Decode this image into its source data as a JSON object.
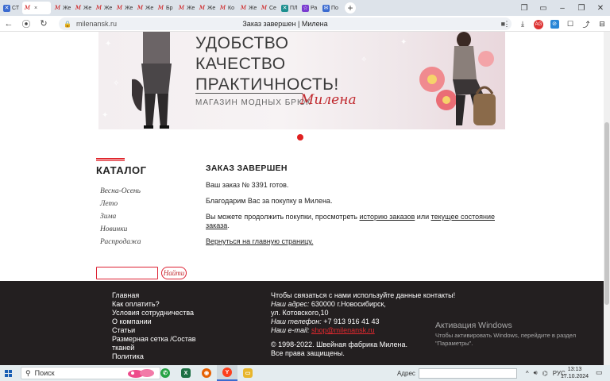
{
  "browser": {
    "tabs": [
      {
        "label": "СТ",
        "icon": "blue",
        "glyph": "✕"
      },
      {
        "label": "",
        "icon": "m",
        "glyph": "M",
        "active": true
      },
      {
        "label": "Же",
        "icon": "m",
        "glyph": "M"
      },
      {
        "label": "Же",
        "icon": "m",
        "glyph": "M"
      },
      {
        "label": "Же",
        "icon": "m",
        "glyph": "M"
      },
      {
        "label": "Же",
        "icon": "m",
        "glyph": "M"
      },
      {
        "label": "Же",
        "icon": "m",
        "glyph": "M"
      },
      {
        "label": "Бр",
        "icon": "m",
        "glyph": "M"
      },
      {
        "label": "Же",
        "icon": "m",
        "glyph": "M"
      },
      {
        "label": "Же",
        "icon": "m",
        "glyph": "M"
      },
      {
        "label": "Ко",
        "icon": "m",
        "glyph": "M"
      },
      {
        "label": "Же",
        "icon": "m",
        "glyph": "M"
      },
      {
        "label": "Се",
        "icon": "m",
        "glyph": "M"
      },
      {
        "label": "ПЛ",
        "icon": "teal",
        "glyph": "✕"
      },
      {
        "label": "Ра",
        "icon": "purple",
        "glyph": "☆"
      },
      {
        "label": "По",
        "icon": "blue",
        "glyph": "✉"
      }
    ],
    "url": "milenansk.ru",
    "page_title": "Заказ завершен | Милена"
  },
  "banner": {
    "line1": "УДОБСТВО",
    "line2": "КАЧЕСТВО",
    "line3": "ПРАКТИЧНОСТЬ!",
    "shop": "МАГАЗИН МОДНЫХ БРЮК",
    "brand": "Милена"
  },
  "catalog": {
    "title": "КАТАЛОГ",
    "items": [
      "Весна-Осень",
      "Лето",
      "Зима",
      "Новинки",
      "Распродажа"
    ]
  },
  "order": {
    "heading": "ЗАКАЗ ЗАВЕРШЕН",
    "number_text": "Ваш заказ № 3391 готов.",
    "thanks": "Благодарим Вас за покупку в Милена.",
    "continue_pre": "Вы можете продолжить покупки, просмотреть ",
    "history_link": "историю заказов",
    "or": " или ",
    "status_link": "текущее состояние заказа",
    "dot": ".",
    "back_link": "Вернуться на главную страницу."
  },
  "search": {
    "placeholder": "",
    "button": "Найти"
  },
  "footer": {
    "nav": [
      "Главная",
      "Как оплатить?",
      "Условия сотрудничества",
      "О компании",
      "Статьи",
      "Размерная сетка /Состав тканей",
      "Политика"
    ],
    "contact_intro": "Чтобы связаться с нами используйте данные контакты!",
    "addr_label": "Наш адрес:",
    "addr_value": " 630000 г.Новосибирск,",
    "addr_value2": "ул. Котовского,10",
    "phone_label": "Наш телефон:",
    "phone_value": " +7 913 916 41 43",
    "email_label": "Наш e-mail:",
    "email_value": "shop@milenansk.ru",
    "copyright": "© 1998-2022. Швейная фабрика Милена.",
    "rights": "Все права защищены."
  },
  "watermark": {
    "title": "Активация Windows",
    "text": "Чтобы активировать Windows, перейдите в раздел \"Параметры\"."
  },
  "taskbar": {
    "search_label": "Поиск",
    "address_label": "Адрес",
    "lang": "РУС",
    "time": "13:13",
    "date": "17.10.2024"
  },
  "colors": {
    "accent": "#e0282e",
    "footer_bg": "#231f20"
  }
}
